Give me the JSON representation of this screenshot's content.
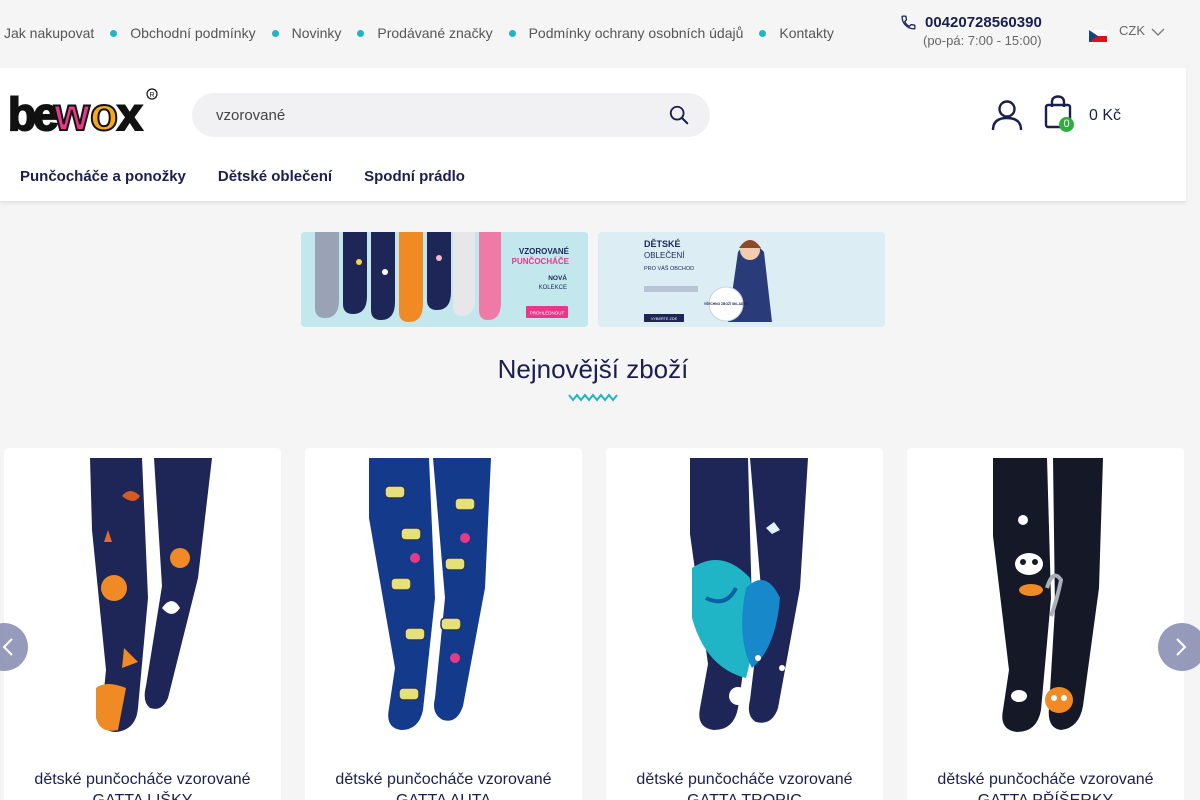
{
  "topbar": {
    "links": [
      "Jak nakupovat",
      "Obchodní podmínky",
      "Novinky",
      "Prodávané značky",
      "Podmínky ochrany osobních údajů",
      "Kontakty"
    ],
    "phone": "00420728560390",
    "hours": "(po-pá: 7:00 - 15:00)",
    "currency": "CZK"
  },
  "header": {
    "logo_text": "bewox",
    "search_value": "vzorované",
    "cart_count": "0",
    "cart_total": "0 Kč"
  },
  "nav": [
    "Punčocháče a ponožky",
    "Dětské oblečení",
    "Spodní prádlo"
  ],
  "banners": {
    "b1": {
      "title": "VZOROVANÉ",
      "title2": "PUNČOCHÁČE",
      "sub": "NOVÁ",
      "sub2": "KOLEKCE",
      "cta": "PROHLÉDNOUT"
    },
    "b2": {
      "title": "DĚTSKÉ",
      "title2": "OBLEČENÍ",
      "sub": "PRO VÁŠ OBCHOD",
      "badge": "VŠECHNO ZBOŽÍ SKLADEM",
      "cta": "VYBERTE ZDE"
    }
  },
  "section": {
    "title": "Nejnovější zboží"
  },
  "products": [
    {
      "name": "dětské punčocháče vzorované GATTA LIŠKY",
      "pattern": "foxes"
    },
    {
      "name": "dětské punčocháče vzorované GATTA AUTA",
      "pattern": "cars"
    },
    {
      "name": "dětské punčocháče vzorované GATTA TROPIC",
      "pattern": "tropic"
    },
    {
      "name": "dětské punčocháče vzorované GATTA PŘÍŠERKY",
      "pattern": "monsters"
    }
  ],
  "colors": {
    "accent": "#1fb5c7",
    "navy": "#1a1f4e",
    "badge": "#2eae3f"
  }
}
